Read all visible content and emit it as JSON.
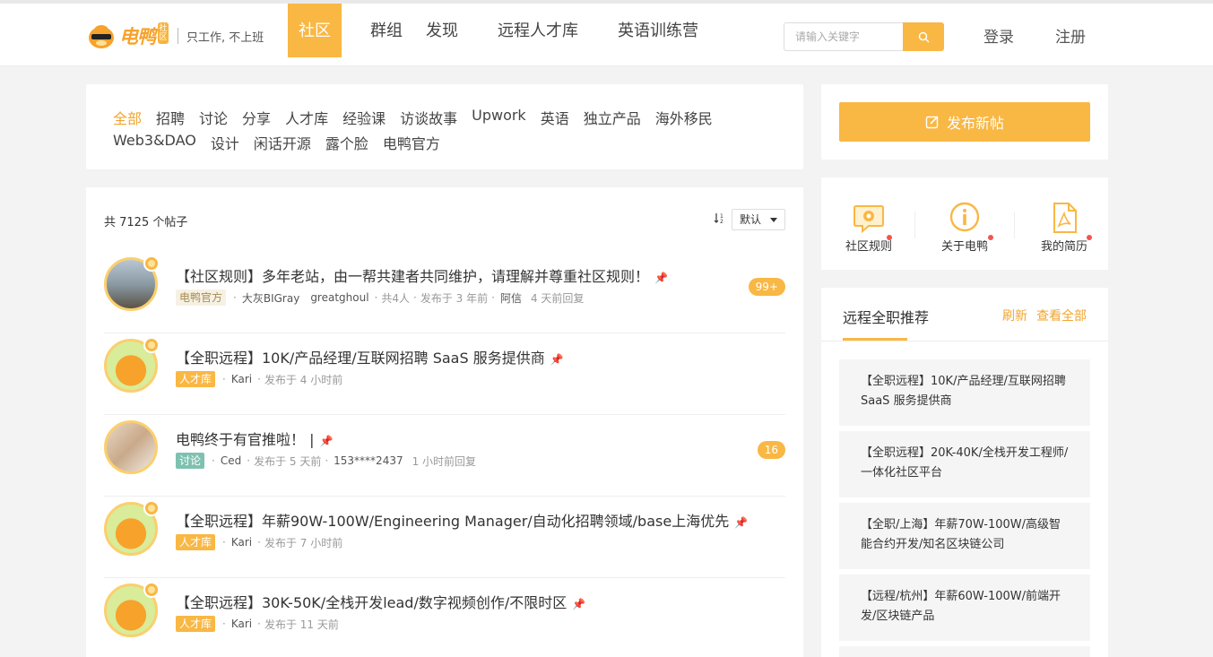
{
  "header": {
    "logo_text": "电鸭",
    "logo_badge": "社区",
    "slogan": "只工作, 不上班",
    "nav": [
      {
        "label": "社区",
        "active": true
      },
      {
        "label": "群组"
      },
      {
        "label": "发现"
      },
      {
        "label": "远程人才库"
      },
      {
        "label": "英语训练营"
      }
    ],
    "search_placeholder": "请输入关键字",
    "login": "登录",
    "register": "注册"
  },
  "categories": {
    "row1": [
      "全部",
      "招聘",
      "讨论",
      "分享",
      "人才库",
      "经验课",
      "访谈故事",
      "Upwork",
      "英语",
      "独立产品",
      "海外移民"
    ],
    "row2": [
      "Web3&DAO",
      "设计",
      "闲话开源",
      "露个脸",
      "电鸭官方"
    ],
    "active": "全部"
  },
  "posts_header": {
    "count_text": "共 7125 个帖子",
    "sort_value": "默认"
  },
  "posts": [
    {
      "title": "【社区规则】多年老站，由一帮共建者共同维护，请理解并尊重社区规则！",
      "tag": "电鸭官方",
      "author": "大灰BIGray",
      "participant": "greatghoul",
      "people": "共4人",
      "published": "发布于 3 年前",
      "replier": "阿信",
      "replied": "4 天前回复",
      "count": "99+"
    },
    {
      "title": "【全职远程】10K/产品经理/互联网招聘 SaaS 服务提供商",
      "tag": "人才库",
      "author": "Kari",
      "published": "发布于 4 小时前"
    },
    {
      "title": "电鸭终于有官推啦！ |",
      "tag": "讨论",
      "author": "Ced",
      "published": "发布于 5 天前",
      "replier": "153****2437",
      "replied": "1 小时前回复",
      "count": "16"
    },
    {
      "title": "【全职远程】年薪90W-100W/Engineering Manager/自动化招聘领域/base上海优先",
      "tag": "人才库",
      "author": "Kari",
      "published": "发布于 7 小时前"
    },
    {
      "title": "【全职远程】30K-50K/全栈开发lead/数字视频创作/不限时区",
      "tag": "人才库",
      "author": "Kari",
      "published": "发布于 11 天前"
    }
  ],
  "sidebar": {
    "publish_label": "发布新帖",
    "quick_links": [
      {
        "label": "社区规则",
        "icon": "rules-chat-icon"
      },
      {
        "label": "关于电鸭",
        "icon": "info-icon"
      },
      {
        "label": "我的简历",
        "icon": "pdf-resume-icon"
      }
    ],
    "recommend": {
      "title": "远程全职推荐",
      "refresh": "刷新",
      "view_all": "查看全部",
      "items": [
        "【全职远程】10K/产品经理/互联网招聘 SaaS 服务提供商",
        "【全职远程】20K-40K/全栈开发工程师/一体化社区平台",
        "【全职/上海】年薪70W-100W/高级智能合约开发/知名区块链公司",
        "【远程/杭州】年薪60W-100W/前端开发/区块链产品"
      ]
    }
  },
  "colors": {
    "accent": "#f9b744",
    "accent_text": "#f0a52e",
    "discuss_tag": "#7fc1b0",
    "notice_dot": "#f4544d"
  }
}
